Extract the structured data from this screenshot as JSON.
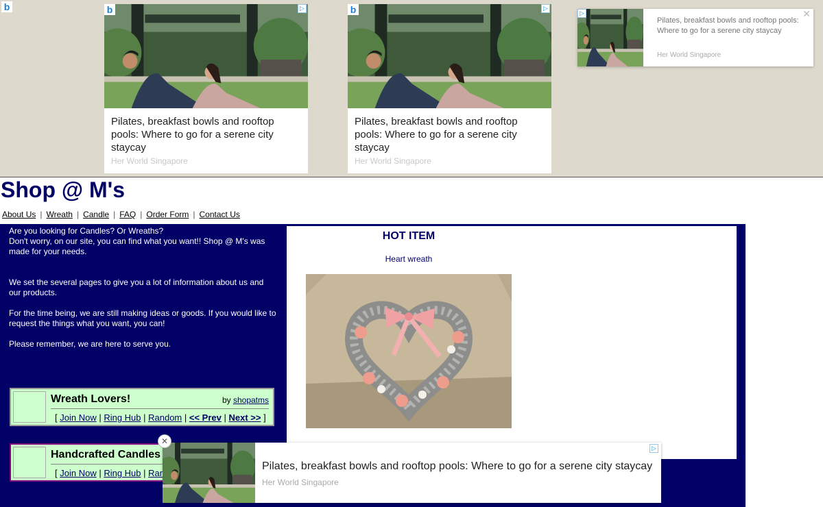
{
  "ads": {
    "headline": "Pilates, breakfast bowls and rooftop pools: Where to go for a serene city staycay",
    "source": "Her World Singapore",
    "bing_glyph": "b",
    "adchoices_glyph": "▷",
    "close_glyph": "✕"
  },
  "site": {
    "title": "Shop @ M's",
    "nav": [
      "About Us",
      "Wreath",
      "Candle",
      "FAQ",
      "Order Form",
      "Contact Us"
    ]
  },
  "intro": {
    "p1a": "Are you looking for Candles? Or Wreaths?",
    "p1b": "Don't worry, on our site, you can find what you want!! Shop @ M's was made for your needs.",
    "p2": "We set the several pages to give you a lot of information about us and our products.",
    "p3": "For the time being, we are still making ideas or goods. If you would like to request the things what you want, you can!",
    "p4": "Please remember, we are here to serve you."
  },
  "hot_item": {
    "title": "HOT ITEM",
    "name": "Heart wreath"
  },
  "webrings": [
    {
      "name": "Wreath Lovers!",
      "by": "by",
      "owner": "shopatms",
      "links": [
        "Join Now",
        "Ring Hub",
        "Random",
        "<< Prev",
        "Next >>"
      ]
    },
    {
      "name": "Handcrafted Candles",
      "links": [
        "Join Now",
        "Ring Hub",
        "Random"
      ]
    }
  ],
  "colors": {
    "navy": "#000066",
    "ring_bg": "#ccffcc",
    "adband_bg": "#ded9cd"
  }
}
